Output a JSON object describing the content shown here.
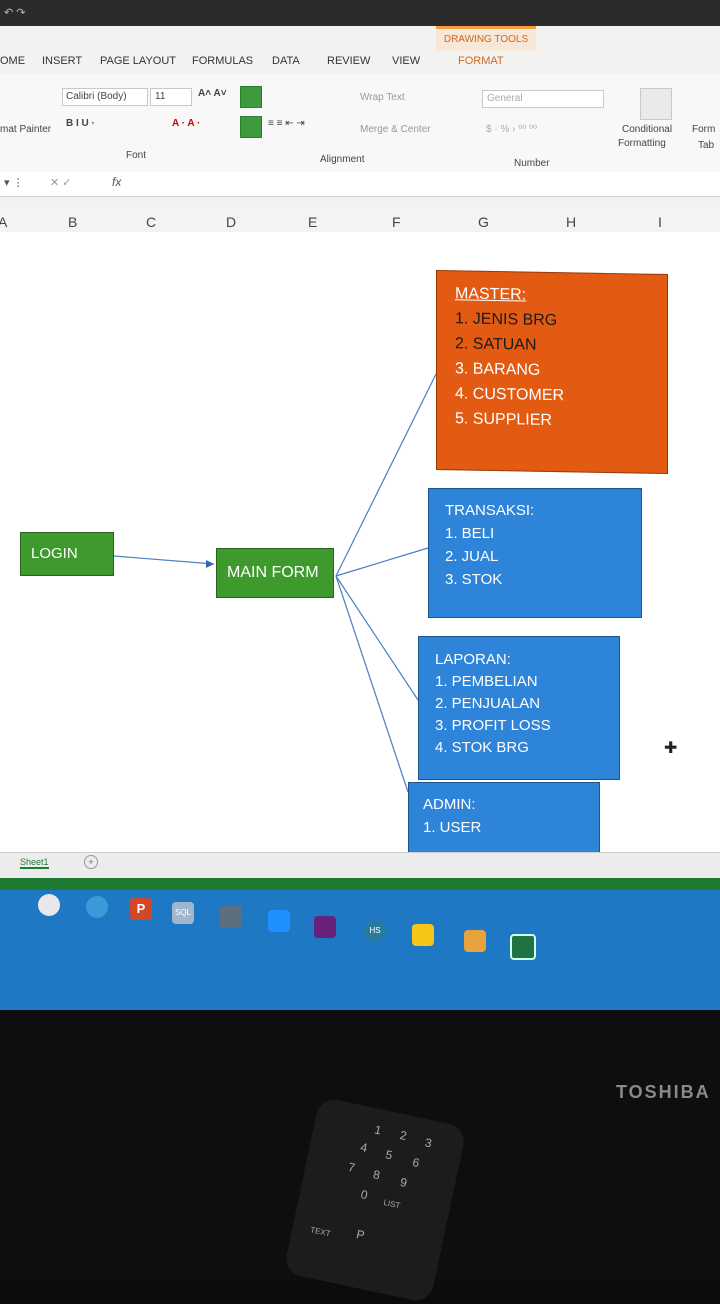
{
  "ribbon": {
    "contextual_tab": "DRAWING TOOLS",
    "tabs": [
      "OME",
      "INSERT",
      "PAGE LAYOUT",
      "FORMULAS",
      "DATA",
      "REVIEW",
      "VIEW",
      "FORMAT"
    ],
    "font_name": "Calibri (Body)",
    "font_size": "11",
    "wrap_text": "Wrap Text",
    "merge_center": "Merge & Center",
    "number_format": "General",
    "format_painter": "mat Painter",
    "groups": {
      "font": "Font",
      "alignment": "Alignment",
      "number": "Number"
    },
    "conditional_formatting": [
      "Conditional",
      "Formatting"
    ],
    "format_as_table": [
      "Form",
      "Tab"
    ],
    "fx": "fx"
  },
  "columns": [
    "A",
    "B",
    "C",
    "D",
    "E",
    "F",
    "G",
    "H",
    "I"
  ],
  "diagram": {
    "login": "LOGIN",
    "main_form": "MAIN FORM",
    "master": [
      "MASTER:",
      "1. JENIS BRG",
      "2. SATUAN",
      "3. BARANG",
      "4. CUSTOMER",
      "5. SUPPLIER"
    ],
    "transaksi": [
      "TRANSAKSI:",
      "1. BELI",
      "2. JUAL",
      "3. STOK"
    ],
    "laporan": [
      "LAPORAN:",
      "1. PEMBELIAN",
      "2. PENJUALAN",
      "3. PROFIT LOSS",
      "4. STOK BRG"
    ],
    "admin": [
      "ADMIN:",
      "1. USER"
    ],
    "colors": {
      "green": "#3e9a2c",
      "orange": "#e35b12",
      "blue": "#2e84d8"
    }
  },
  "sheet_tab": "Sheet1",
  "taskbar": {
    "sql_label": "SQL",
    "hs_label": "HS",
    "p_label": "P"
  },
  "monitor": {
    "brand": "TOSHIBA"
  },
  "remote": {
    "keys": [
      "1",
      "2",
      "3",
      "4",
      "5",
      "6",
      "7",
      "8",
      "9",
      "0",
      "LIST",
      "TEXT",
      "P"
    ]
  }
}
